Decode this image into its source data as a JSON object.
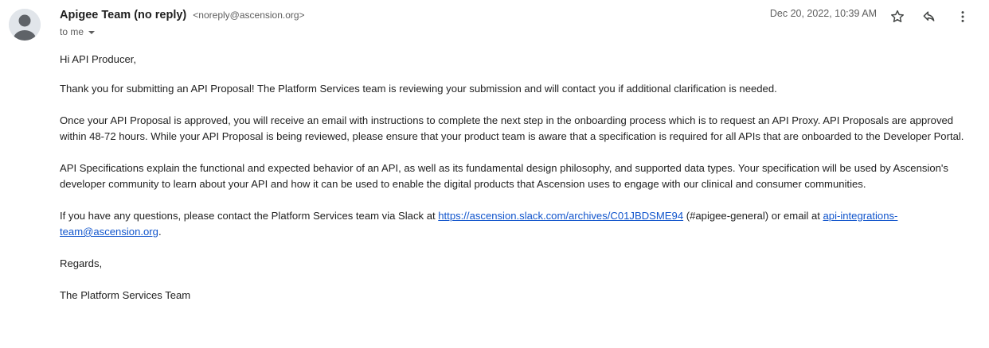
{
  "sender": {
    "name": "Apigee Team (no reply)",
    "email": "<noreply@ascension.org>"
  },
  "recipient": {
    "label": "to me"
  },
  "meta": {
    "date": "Dec 20, 2022, 10:39 AM"
  },
  "icons": {
    "avatar": "person-avatar-icon",
    "star": "star-icon",
    "reply": "reply-icon",
    "more": "more-vertical-icon",
    "recipient_dropdown": "caret-down-icon"
  },
  "colors": {
    "link": "#1155cc",
    "avatar_bg": "#e1e5ea",
    "avatar_fg": "#5f6368",
    "secondary_text": "#5e5e5e"
  },
  "body": {
    "greeting": "Hi API Producer,",
    "p1": "Thank you for submitting an API Proposal! The Platform Services team is reviewing your submission and will contact you if additional clarification is needed.",
    "p2": "Once your API Proposal is approved, you will receive an email with instructions to complete the next step in the onboarding process which is to request an API Proxy. API Proposals are approved within 48-72 hours. While your API Proposal is being reviewed, please ensure that your product team is aware that a specification is required for all APIs that are onboarded to the Developer Portal.",
    "p3": "API Specifications explain the functional and expected behavior of an API, as well as its fundamental design philosophy, and supported data types. Your specification will be used by Ascension's developer community to learn about your API and how it can be used to enable the digital products that Ascension uses to engage with our clinical and consumer communities.",
    "p4_prefix": "If you have any questions, please contact the Platform Services team via Slack at ",
    "slack_link": "https://ascension.slack.com/archives/C01JBDSME94",
    "p4_middle": " (#apigee-general) or email at ",
    "email_link": "api-integrations-team@ascension.org",
    "p4_suffix": ".",
    "signoff": "Regards,",
    "signature": "The Platform Services Team"
  }
}
